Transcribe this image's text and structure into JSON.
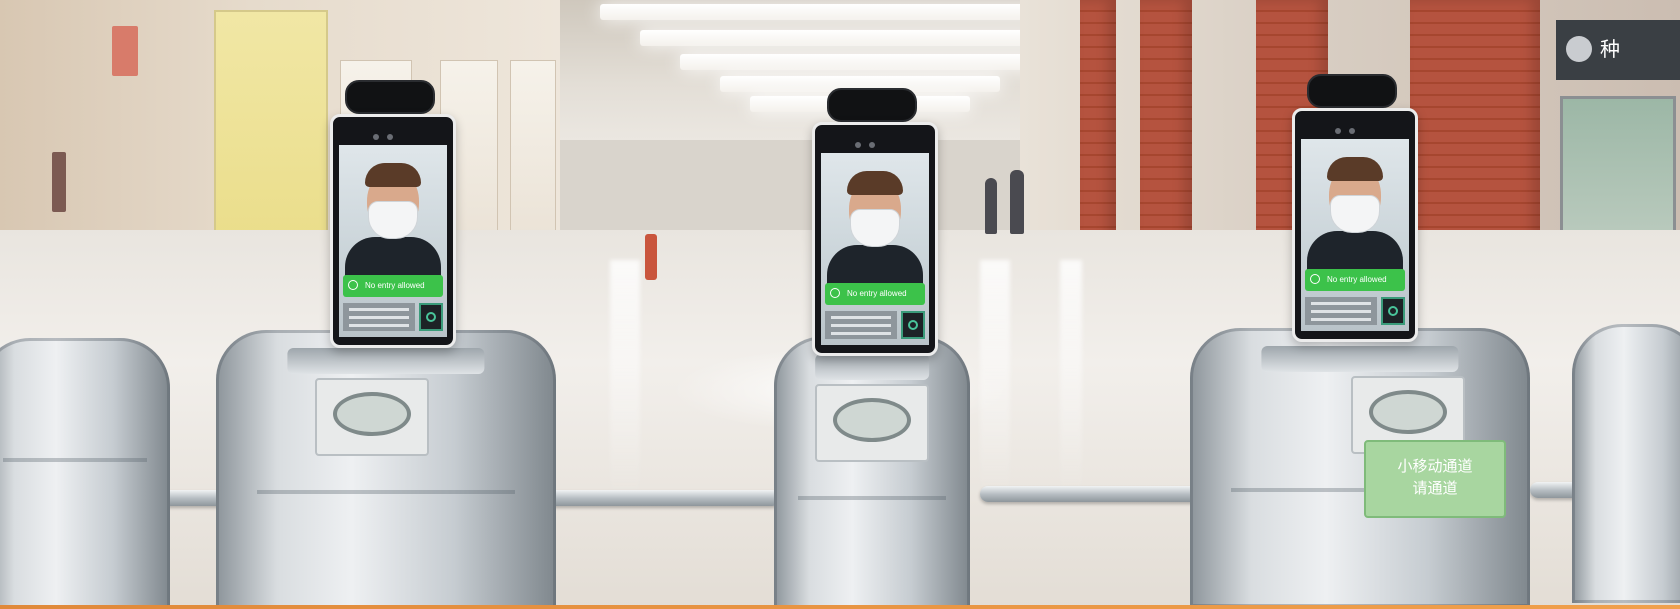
{
  "scene": {
    "kind": "photo",
    "kiosks": [
      {
        "screen_status": "No entry allowed",
        "status_color": "#3cc24a"
      },
      {
        "screen_status": "No entry allowed",
        "status_color": "#3cc24a"
      },
      {
        "screen_status": "No entry allowed",
        "status_color": "#3cc24a"
      }
    ],
    "green_sign_line1": "小移动通道",
    "green_sign_line2": "请通道",
    "shop_sign": "种",
    "accent_color": "#e0893a"
  }
}
